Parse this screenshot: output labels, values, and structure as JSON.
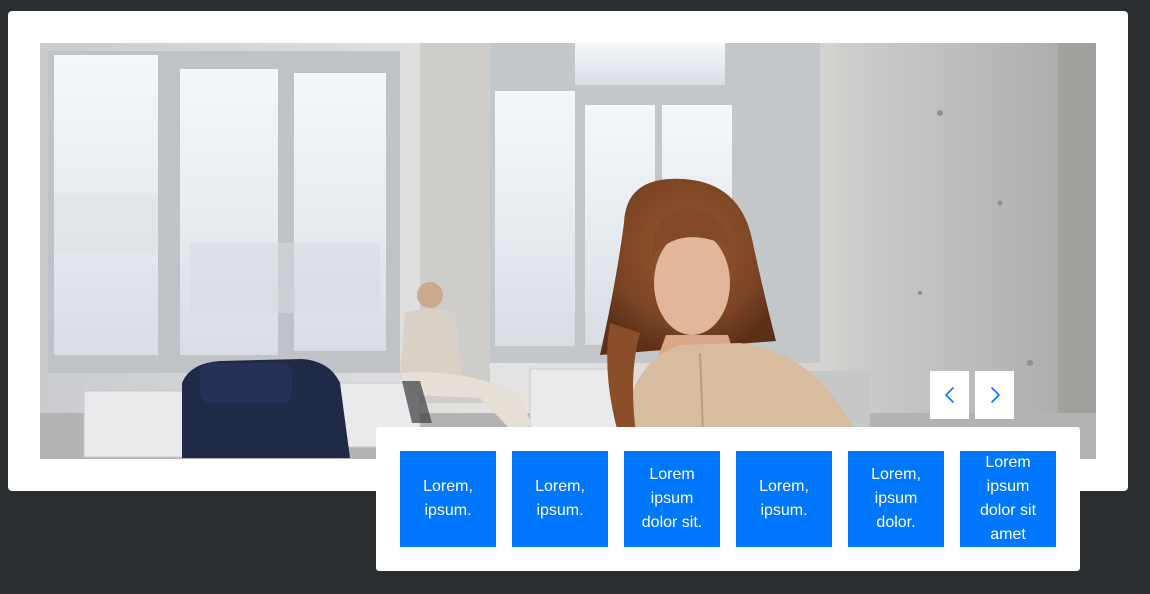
{
  "slider": {
    "photo_alt": "Woman with curly hair reading in a bright loft room",
    "prev_icon": "chevron-left-icon",
    "next_icon": "chevron-right-icon",
    "accent_color": "#0077ff",
    "items": [
      {
        "label": "Lorem, ipsum."
      },
      {
        "label": "Lorem, ipsum."
      },
      {
        "label": "Lorem ipsum dolor sit."
      },
      {
        "label": "Lorem, ipsum."
      },
      {
        "label": "Lorem, ipsum dolor."
      },
      {
        "label": "Lorem ipsum dolor sit amet"
      }
    ]
  }
}
